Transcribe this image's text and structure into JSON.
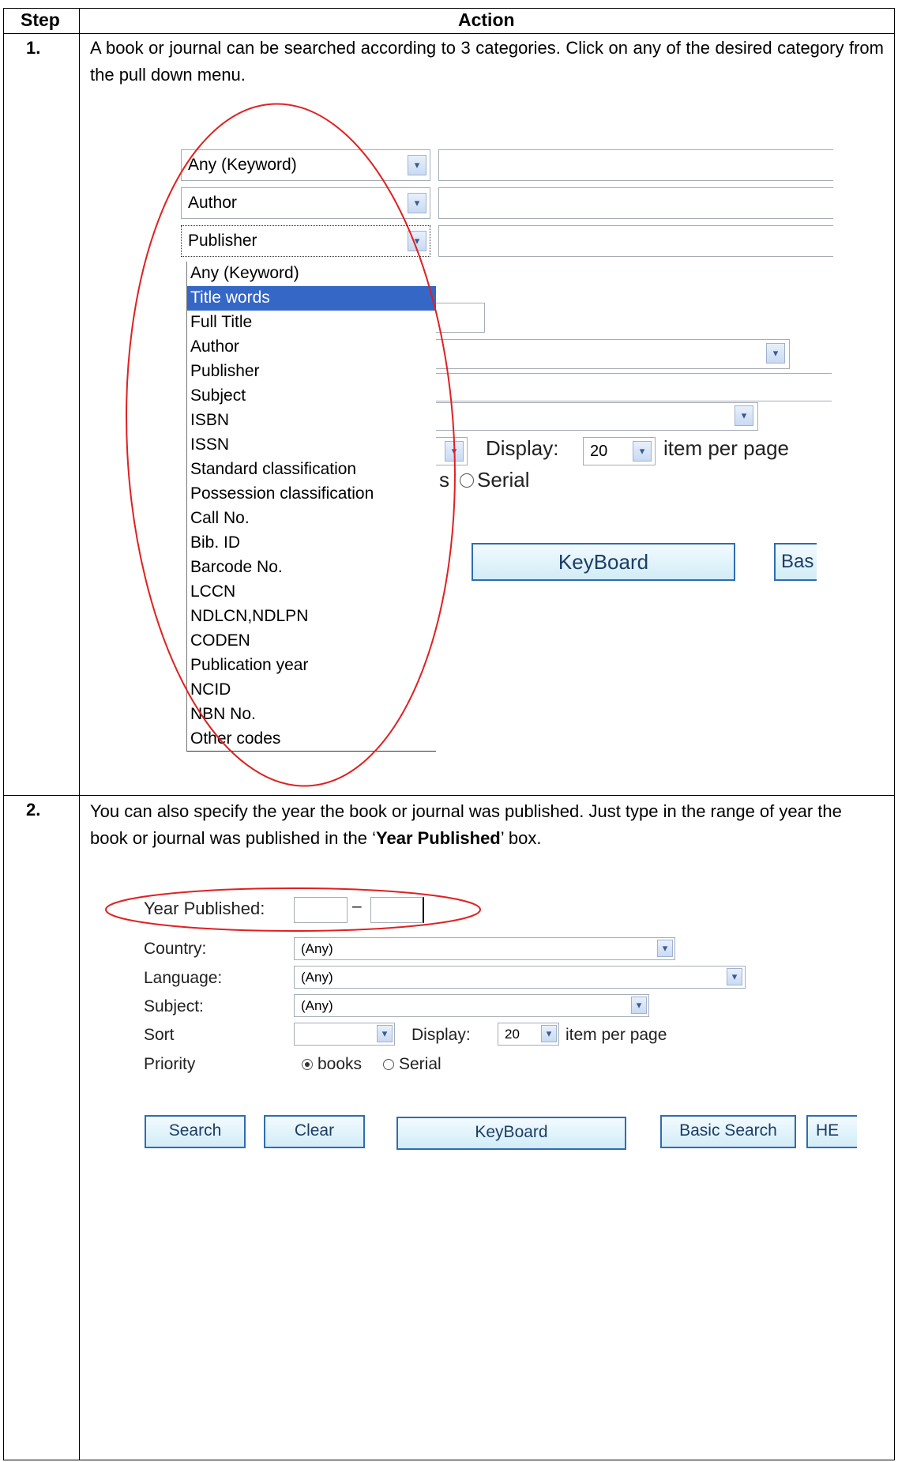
{
  "table": {
    "header_step": "Step",
    "header_action": "Action"
  },
  "step1": {
    "num": "1.",
    "text": "A book or journal can be searched according to 3 categories. Click on any of the desired category from the pull down menu.",
    "field1": "Any (Keyword)",
    "field2": "Author",
    "field3": "Publisher",
    "options": [
      "Any (Keyword)",
      "Title words",
      "Full Title",
      "Author",
      "Publisher",
      "Subject",
      "ISBN",
      "ISSN",
      "Standard classification",
      "Possession classification",
      "Call No.",
      "Bib. ID",
      "Barcode No.",
      "LCCN",
      "NDLCN,NDLPN",
      "CODEN",
      "Publication year",
      "NCID",
      "NBN No.",
      "Other codes"
    ],
    "selected_option": "Title words",
    "display_label": "Display:",
    "display_value": "20",
    "per_page": "item per page",
    "fragment_s": "s",
    "serial_label": "Serial",
    "keyboard_label": "KeyBoard",
    "basic_fragment": "Bas"
  },
  "step2": {
    "num": "2.",
    "text_part1": "You can also specify the year the book or journal was published. Just type in the range of year the book or journal was published in the ‘",
    "text_bold": "Year Published",
    "text_part2": "’ box.",
    "year_label": "Year Published:",
    "year_dash": "–",
    "country_label": "Country:",
    "country_value": "(Any)",
    "language_label": "Language:",
    "language_value": "(Any)",
    "subject_label": "Subject:",
    "subject_value": "(Any)",
    "sort_label": "Sort",
    "display_label": "Display:",
    "display_value": "20",
    "per_page": "item per page",
    "priority_label": "Priority",
    "books_label": "books",
    "serial_label": "Serial",
    "search_label": "Search",
    "clear_label": "Clear",
    "keyboard_label": "KeyBoard",
    "basic_search_label": "Basic Search",
    "help_fragment": "HE"
  },
  "colors": {
    "highlight": "#3567c6",
    "annotation": "#e02020",
    "button_border": "#2f6cb3"
  }
}
